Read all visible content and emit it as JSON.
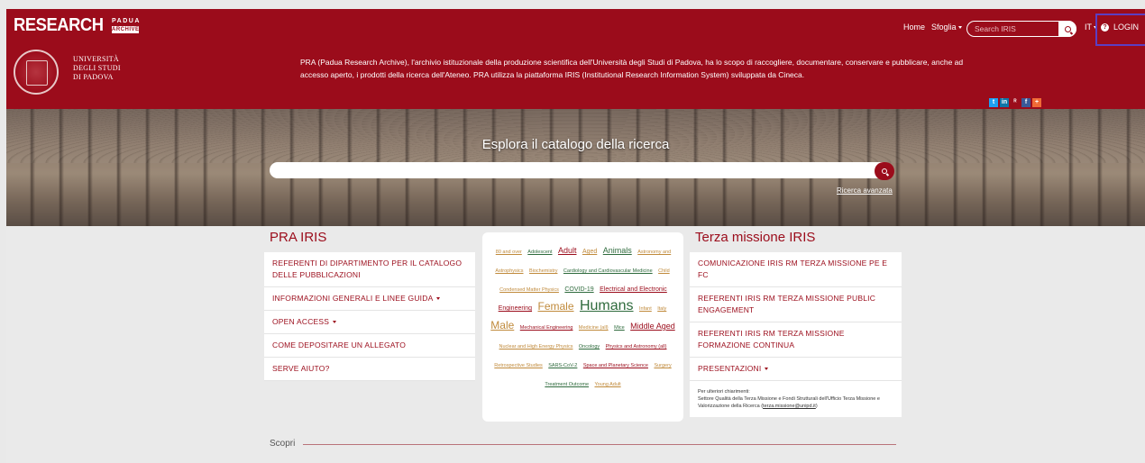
{
  "header": {
    "brand": "RESEARCH",
    "brand_sub1": "PADUA",
    "brand_sub2": "ARCHIVE",
    "university": [
      "Università",
      "degli Studi",
      "di Padova"
    ],
    "intro": "PRA (Padua Research Archive), l'archivio istituzionale della produzione scientifica dell'Università degli Studi di Padova, ha lo scopo di raccogliere, documentare, conservare e pubblicare, anche ad accesso aperto, i prodotti della ricerca dell'Ateneo. PRA utilizza la piattaforma IRIS (Institutional Research Information System) sviluppata da Cineca.",
    "nav": {
      "home": "Home",
      "browse": "Sfoglia"
    },
    "search_placeholder": "Search IRIS",
    "lang": "IT",
    "login": "LOGIN",
    "social": [
      {
        "icon": "twitter-icon",
        "glyph": "t",
        "color": "#1da1f2"
      },
      {
        "icon": "linkedin-icon",
        "glyph": "in",
        "color": "#0e76a8"
      },
      {
        "icon": "researchgate-icon",
        "glyph": "ᴿ",
        "color": "#9b0c1b"
      },
      {
        "icon": "facebook-icon",
        "glyph": "f",
        "color": "#3b5998"
      },
      {
        "icon": "add-icon",
        "glyph": "+",
        "color": "#f06a35"
      }
    ]
  },
  "hero": {
    "title": "Esplora il catalogo della ricerca",
    "search_placeholder": "",
    "advanced": "Ricerca avanzata"
  },
  "left": {
    "title": "PRA IRIS",
    "items": [
      {
        "label": "REFERENTI DI DIPARTIMENTO PER IL CATALOGO DELLE PUBBLICAZIONI",
        "dropdown": false
      },
      {
        "label": "INFORMAZIONI GENERALI E LINEE GUIDA",
        "dropdown": true
      },
      {
        "label": "OPEN ACCESS",
        "dropdown": true
      },
      {
        "label": "COME DEPOSITARE UN ALLEGATO",
        "dropdown": false
      },
      {
        "label": "SERVE AIUTO?",
        "dropdown": false
      }
    ]
  },
  "cloud": {
    "tags": [
      {
        "text": "80 and over",
        "size": 1,
        "tone": "o"
      },
      {
        "text": "Adolescent",
        "size": 1,
        "tone": "g"
      },
      {
        "text": "Adult",
        "size": 3,
        "tone": "r"
      },
      {
        "text": "Aged",
        "size": 2,
        "tone": "o"
      },
      {
        "text": "Animals",
        "size": 3,
        "tone": "g"
      },
      {
        "text": "Astronomy and Astrophysics",
        "size": 1,
        "tone": "o"
      },
      {
        "text": "Biochemistry",
        "size": 1,
        "tone": "o"
      },
      {
        "text": "Cardiology and Cardiovascular Medicine",
        "size": 1,
        "tone": "g"
      },
      {
        "text": "Child",
        "size": 1,
        "tone": "o"
      },
      {
        "text": "Condensed Matter Physics",
        "size": 1,
        "tone": "o"
      },
      {
        "text": "COVID-19",
        "size": 2,
        "tone": "g"
      },
      {
        "text": "Electrical and Electronic Engineering",
        "size": 2,
        "tone": "r"
      },
      {
        "text": "Female",
        "size": 4,
        "tone": "o"
      },
      {
        "text": "Humans",
        "size": 5,
        "tone": "g"
      },
      {
        "text": "Infant",
        "size": 1,
        "tone": "o"
      },
      {
        "text": "Italy",
        "size": 1,
        "tone": "o"
      },
      {
        "text": "Male",
        "size": 4,
        "tone": "g"
      },
      {
        "text": "Mechanical Engineering",
        "size": 1,
        "tone": "r"
      },
      {
        "text": "Medicine (all)",
        "size": 1,
        "tone": "o"
      },
      {
        "text": "Mice",
        "size": 1,
        "tone": "g"
      },
      {
        "text": "Middle Aged",
        "size": 3,
        "tone": "r"
      },
      {
        "text": "Nuclear and High Energy Physics",
        "size": 1,
        "tone": "o"
      },
      {
        "text": "Oncology",
        "size": 1,
        "tone": "g"
      },
      {
        "text": "Physics and Astronomy (all)",
        "size": 1,
        "tone": "r"
      },
      {
        "text": "Retrospective Studies",
        "size": 1,
        "tone": "o"
      },
      {
        "text": "SARS-CoV-2",
        "size": 1,
        "tone": "g"
      },
      {
        "text": "Space and Planetary Science",
        "size": 1,
        "tone": "r"
      },
      {
        "text": "Surgery",
        "size": 1,
        "tone": "o"
      },
      {
        "text": "Treatment Outcome",
        "size": 1,
        "tone": "g"
      },
      {
        "text": "Young Adult",
        "size": 1,
        "tone": "o"
      }
    ]
  },
  "right": {
    "title": "Terza missione IRIS",
    "items": [
      {
        "label": "COMUNICAZIONE IRIS RM TERZA MISSIONE PE E FC",
        "dropdown": false
      },
      {
        "label": "REFERENTI IRIS RM TERZA MISSIONE PUBLIC ENGAGEMENT",
        "dropdown": false
      },
      {
        "label": "REFERENTI IRIS RM TERZA MISSIONE FORMAZIONE CONTINUA",
        "dropdown": false
      },
      {
        "label": "PRESENTAZIONI",
        "dropdown": true
      }
    ],
    "contact_intro": "Per ulteriori chiarimenti:",
    "contact_body": "Settore Qualità della Terza Missione e Fondi Strutturali dell'Ufficio Terza Missione e Valorizzazione della Ricerca",
    "contact_mail": "terza.missione@unipd.it"
  },
  "scopri": "Scopri",
  "colors": {
    "brand": "#9b0c1b",
    "accent_login": "#5b3fc2",
    "tag_green": "#2f6b3d",
    "tag_orange": "#c08a3b"
  }
}
